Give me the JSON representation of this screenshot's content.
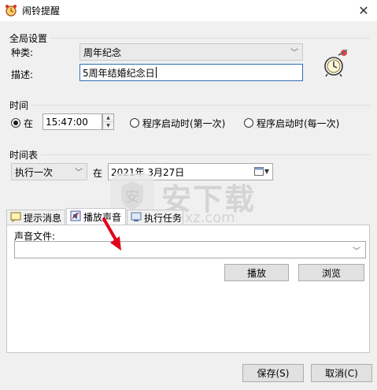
{
  "window": {
    "title": "闹铃提醒",
    "close_glyph": "✕"
  },
  "global": {
    "group_label": "全局设置",
    "type_label": "种类:",
    "type_value": "周年纪念",
    "desc_label": "描述:",
    "desc_value": "5周年结婚纪念日"
  },
  "time": {
    "group_label": "时间",
    "at_label": "在",
    "time_value": "15:47:00",
    "startup_first_label": "程序启动时(第一次)",
    "startup_each_label": "程序启动时(每一次)",
    "selected": "at"
  },
  "schedule": {
    "group_label": "时间表",
    "mode_value": "执行一次",
    "at_label": "在",
    "date_value": "2021年 3月27日"
  },
  "tabs": [
    {
      "label": "提示消息",
      "icon": "message-icon"
    },
    {
      "label": "播放声音",
      "icon": "sound-icon"
    },
    {
      "label": "执行任务",
      "icon": "task-icon"
    }
  ],
  "active_tab": 1,
  "sound": {
    "file_label": "声音文件:",
    "file_value": "",
    "play_label": "播放",
    "browse_label": "浏览"
  },
  "footer": {
    "save_label": "保存(S)",
    "cancel_label": "取消(C)"
  },
  "watermark": {
    "text": "安下载",
    "sub": "anxz.com"
  },
  "colors": {
    "accent_border": "#2f6fb3",
    "arrow": "#e0001b"
  }
}
